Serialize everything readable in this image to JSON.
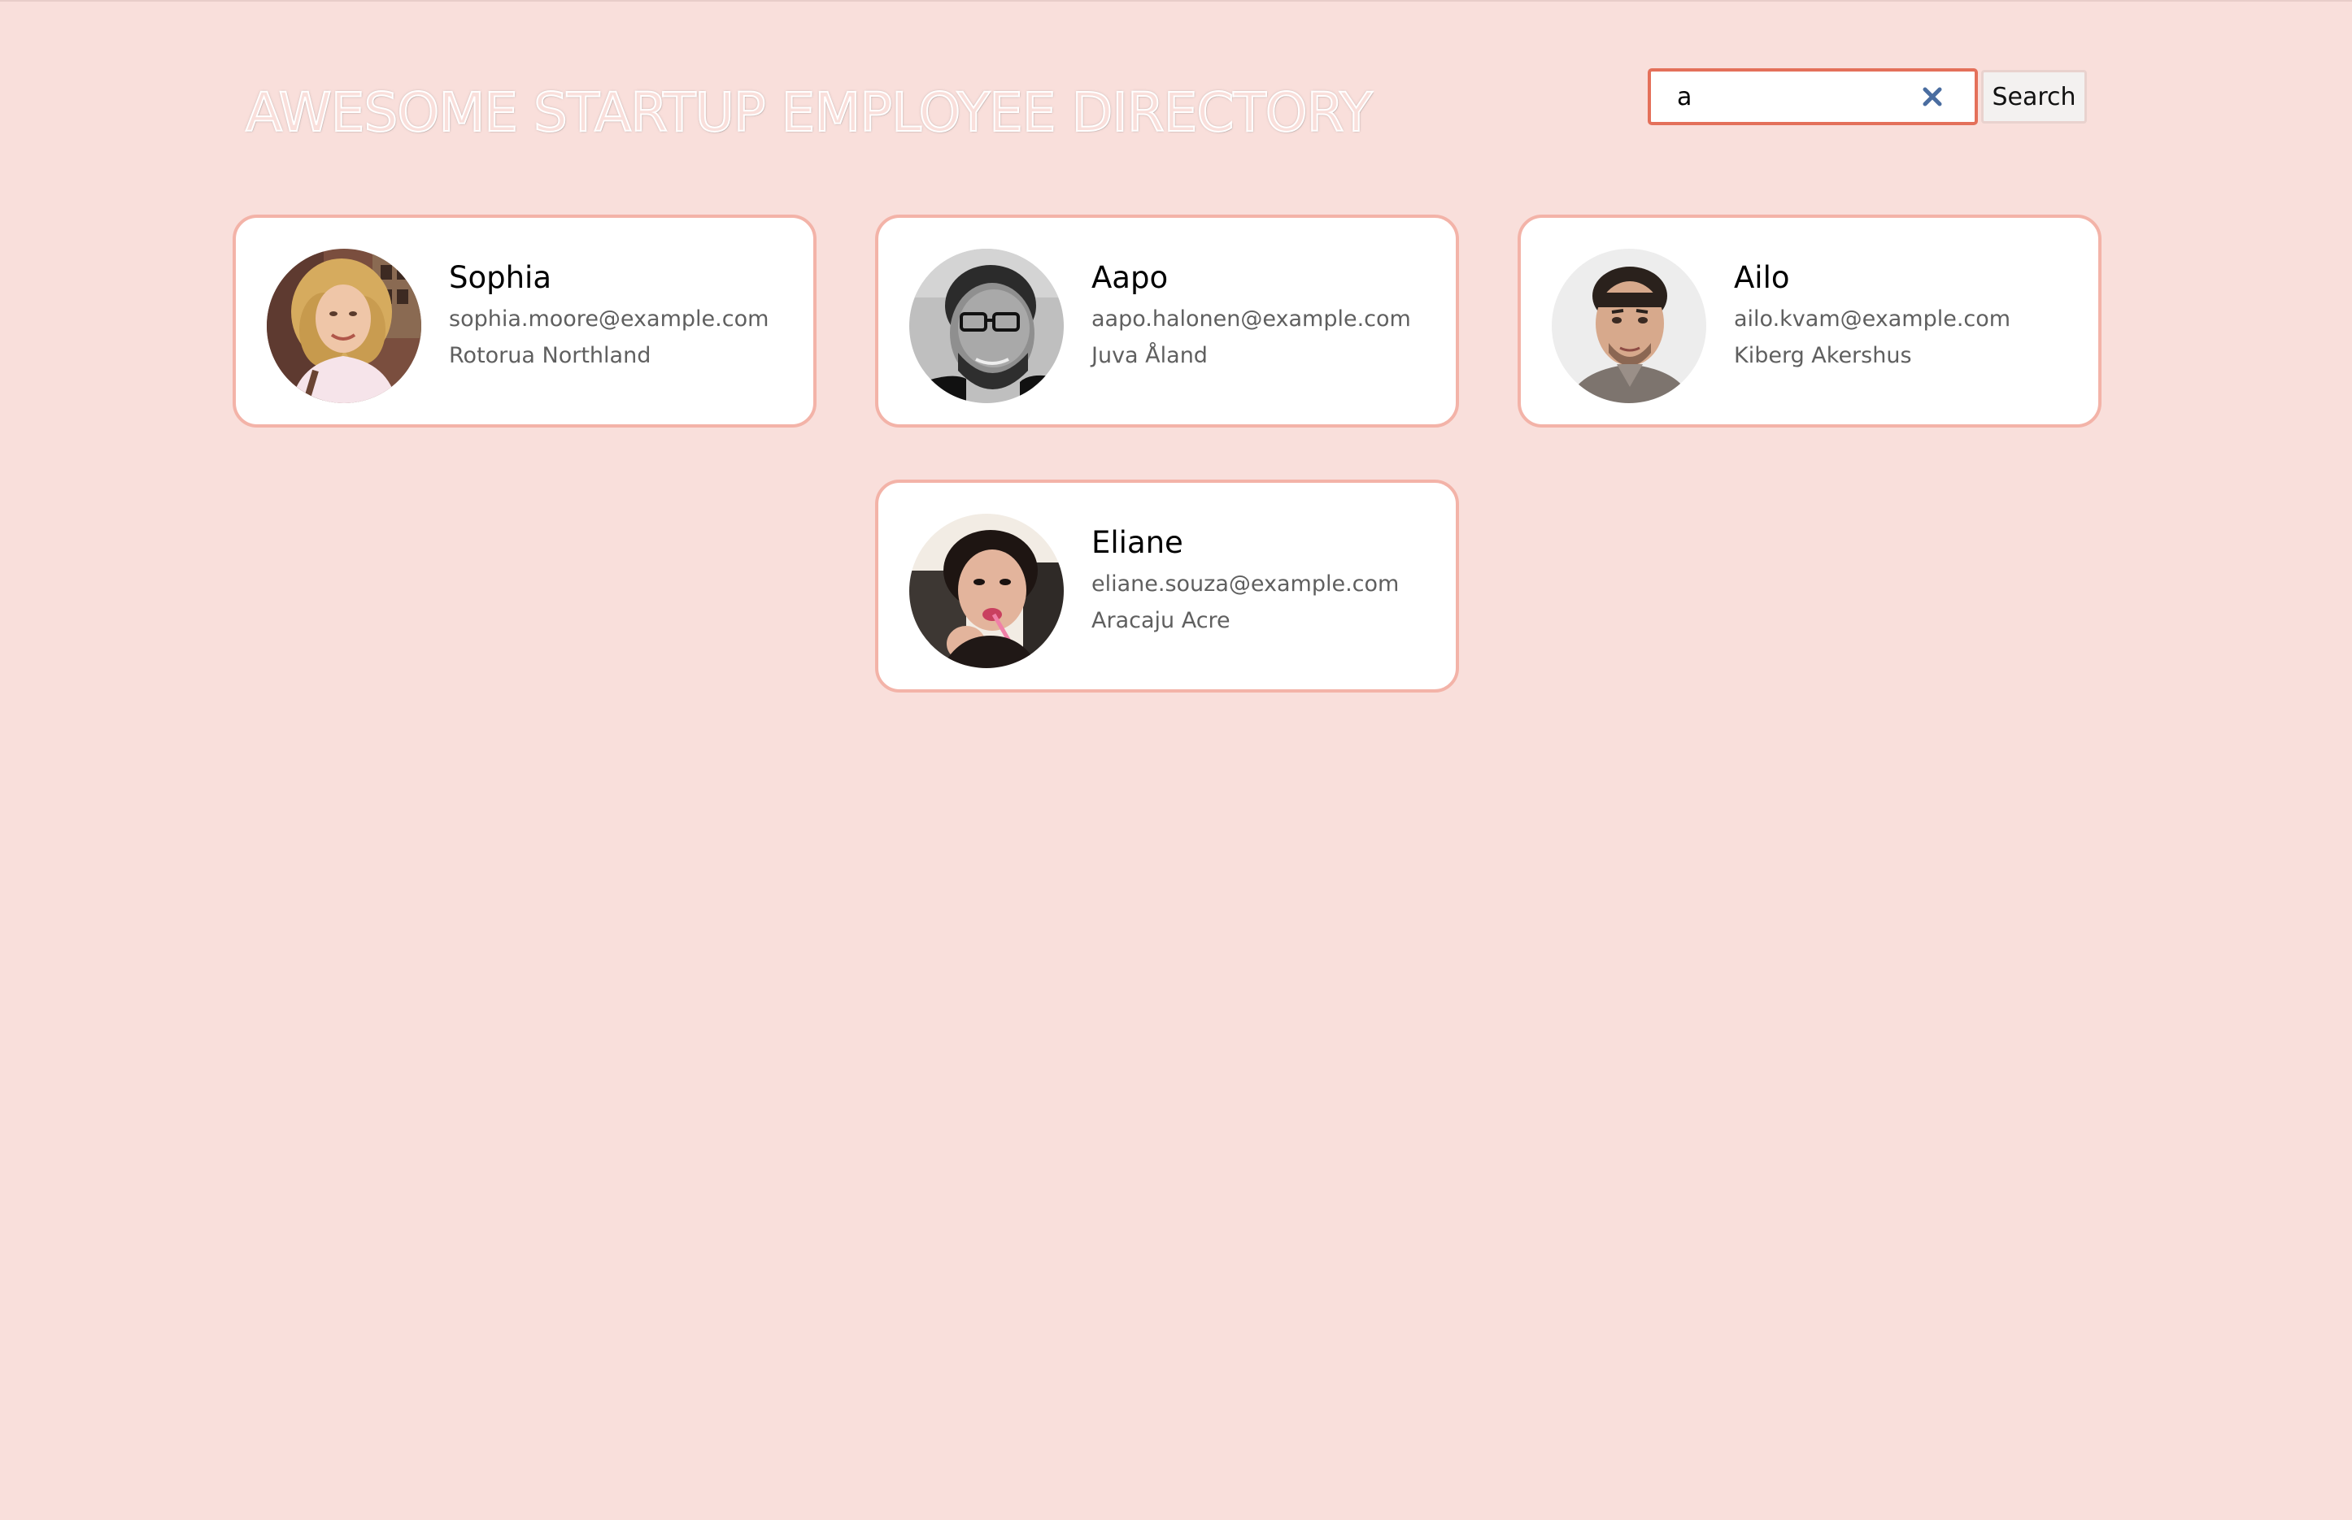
{
  "header": {
    "title": "AWESOME STARTUP EMPLOYEE DIRECTORY"
  },
  "search": {
    "value": "a",
    "clear_icon": "close-icon",
    "button_label": "Search"
  },
  "colors": {
    "background": "#f9dfdb",
    "card_border": "#f3b3a8",
    "search_border": "#e4705a",
    "clear_icon": "#4a6da0"
  },
  "employees": [
    {
      "name": "Sophia",
      "email": "sophia.moore@example.com",
      "location": "Rotorua Northland"
    },
    {
      "name": "Aapo",
      "email": "aapo.halonen@example.com",
      "location": "Juva Åland"
    },
    {
      "name": "Ailo",
      "email": "ailo.kvam@example.com",
      "location": "Kiberg Akershus"
    },
    {
      "name": "Eliane",
      "email": "eliane.souza@example.com",
      "location": "Aracaju Acre"
    }
  ]
}
